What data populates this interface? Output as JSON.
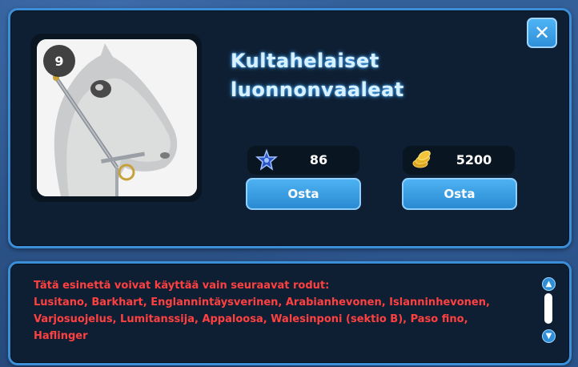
{
  "item": {
    "level": "9",
    "title_line1": "Kultahelaiset",
    "title_line2": "luonnonvaaleat",
    "image": "grey-horse-with-bridle"
  },
  "prices": [
    {
      "currency_icon": "star-coin-icon",
      "value": "86",
      "buy_label": "Osta"
    },
    {
      "currency_icon": "gold-coins-icon",
      "value": "5200",
      "buy_label": "Osta"
    }
  ],
  "close_icon": "close-icon",
  "restriction": {
    "heading": "Tätä esinettä voivat käyttää vain seuraavat rodut:",
    "line1": "Lusitano, Barkhart, Englannintäysverinen, Arabianhevonen, Islanninhevonen,",
    "line2": "Varjosuojelus, Lumitanssija, Appaloosa, Walesinponi (sektio B), Paso fino,",
    "line3": "Haflinger"
  },
  "colors": {
    "panel_bg": "#0f1f33",
    "panel_border": "#3a8fd8",
    "button_blue": "#2e8fd8",
    "warning_red": "#ff4040",
    "title_glow": "#3aa6ff"
  }
}
